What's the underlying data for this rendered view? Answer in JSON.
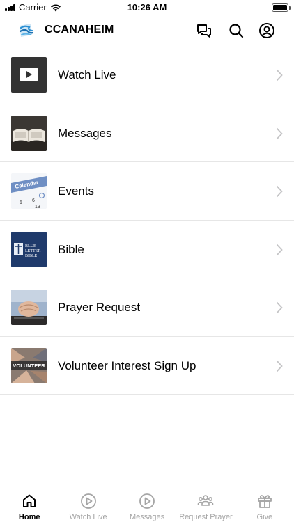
{
  "status_bar": {
    "carrier": "Carrier",
    "time": "10:26 AM"
  },
  "header": {
    "title": "CCANAHEIM"
  },
  "menu": [
    {
      "label": "Watch Live"
    },
    {
      "label": "Messages"
    },
    {
      "label": "Events",
      "thumb_text": "Calendar",
      "thumb_numbers": [
        "5",
        "6",
        "13"
      ]
    },
    {
      "label": "Bible",
      "thumb_text": [
        "BLUE",
        "LETTER",
        "BIBLE"
      ]
    },
    {
      "label": "Prayer Request"
    },
    {
      "label": "Volunteer Interest Sign Up",
      "thumb_text": "VOLUNTEER"
    }
  ],
  "tabs": [
    {
      "label": "Home",
      "active": true
    },
    {
      "label": "Watch Live",
      "active": false
    },
    {
      "label": "Messages",
      "active": false
    },
    {
      "label": "Request Prayer",
      "active": false
    },
    {
      "label": "Give",
      "active": false
    }
  ],
  "colors": {
    "accent": "#000000",
    "inactive_tab": "#a5a5a5",
    "divider": "#e6e6e6",
    "bible_blue": "#1f3a6b"
  }
}
